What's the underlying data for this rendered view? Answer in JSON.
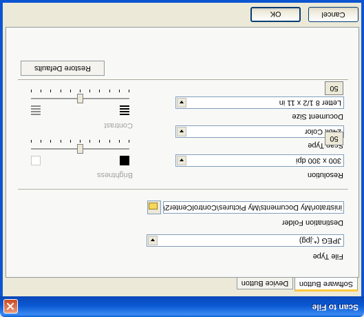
{
  "window": {
    "title": "Scan to File"
  },
  "tabs": [
    {
      "label": "Software Button",
      "active": true
    },
    {
      "label": "Device Button",
      "active": false
    }
  ],
  "file_type": {
    "label": "File Type",
    "value": "JPEG (*.jpg)"
  },
  "destination": {
    "label": "Destination Folder",
    "value": "inistrator\\My Documents\\My Pictures\\ControlCenter2\\",
    "browse_icon": "folder-icon"
  },
  "resolution": {
    "label": "Resolution",
    "value": "300 x 300 dpi"
  },
  "scan_type": {
    "label": "Scan Type",
    "value": "24bit Color"
  },
  "document_size": {
    "label": "Document Size",
    "value": "Letter 8 1/2 x 11 in"
  },
  "brightness": {
    "label": "Brightness",
    "value": "50",
    "level": 0.5
  },
  "contrast": {
    "label": "Contrast",
    "value": "50",
    "level": 0.5
  },
  "restore_defaults": {
    "label": "Restore Defaults"
  },
  "buttons": {
    "ok": "OK",
    "cancel": "Cancel"
  },
  "colors": {
    "title_bar": "#0b58d2",
    "dialog_bg": "#ece9d8",
    "active_tab_accent": "#ffc83c",
    "close_button": "#c84a23"
  }
}
